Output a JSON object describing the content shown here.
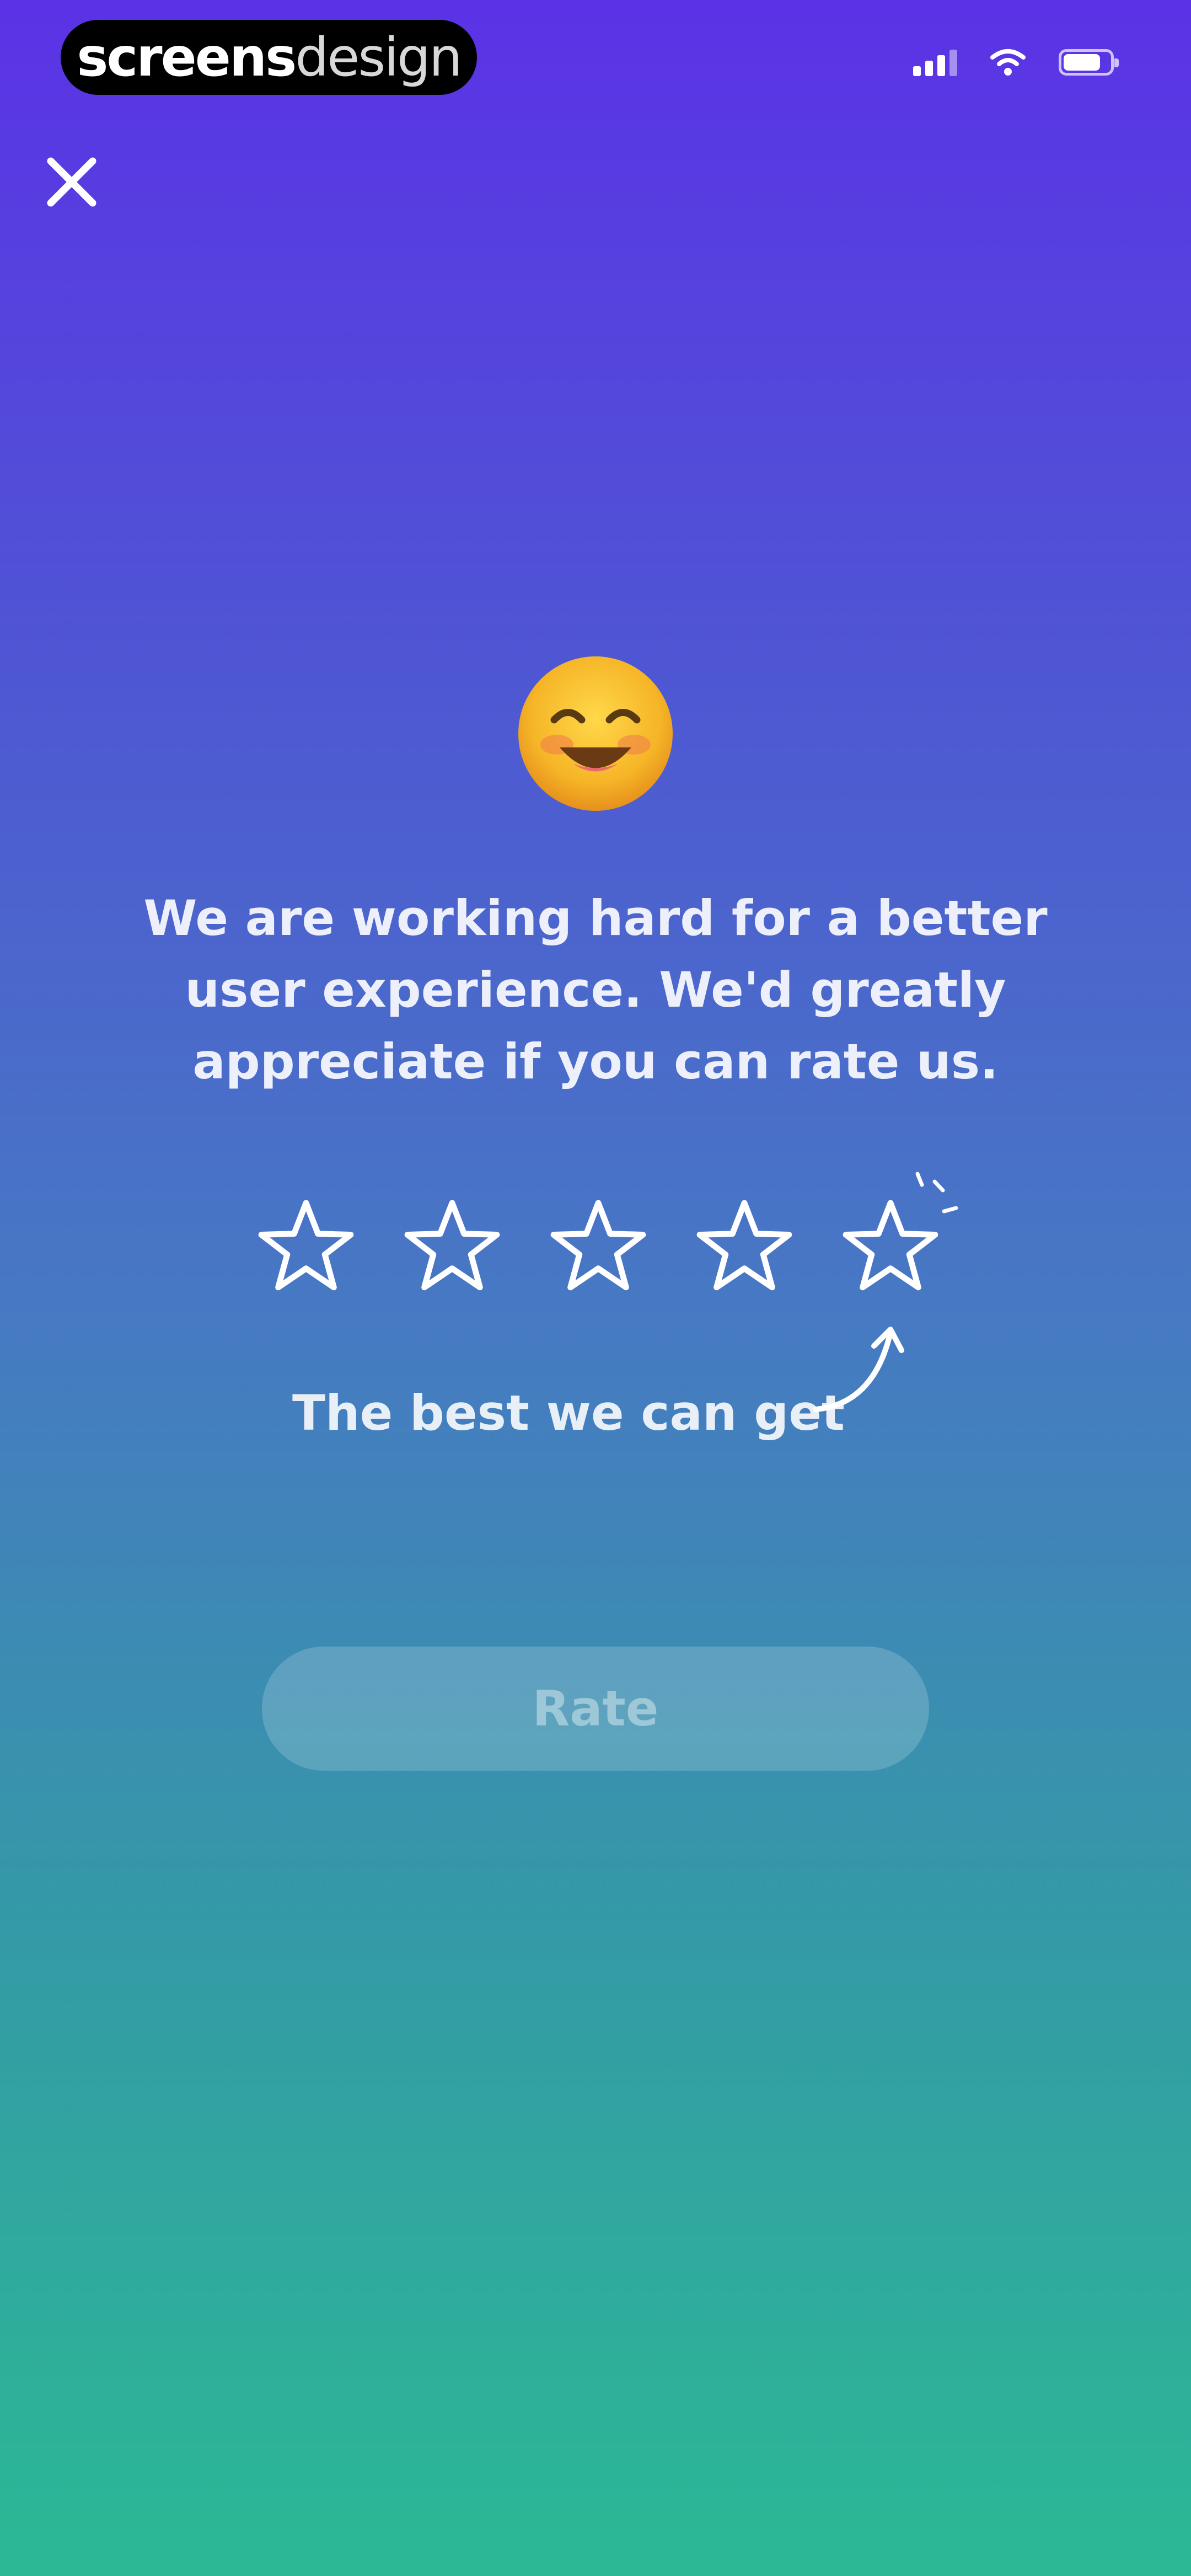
{
  "status_bar": {
    "brand_bold": "screens",
    "brand_light": "design",
    "icons": [
      "signal-icon",
      "wifi-icon",
      "battery-icon"
    ],
    "battery_level": 0.8
  },
  "header": {
    "close_icon": "close-icon"
  },
  "content": {
    "emoji": "smiling-face-icon",
    "message": "We are working hard for a better user experience. We'd greatly appreciate if you can rate us.",
    "stars": [
      {
        "icon": "star-icon",
        "filled": false
      },
      {
        "icon": "star-icon",
        "filled": false
      },
      {
        "icon": "star-icon",
        "filled": false
      },
      {
        "icon": "star-icon",
        "filled": false
      },
      {
        "icon": "star-icon",
        "filled": false
      }
    ],
    "rating": 0,
    "max_rating": 5,
    "hint": "The best we can get",
    "rate_button_label": "Rate",
    "rate_button_enabled": false
  },
  "colors": {
    "gradient_top": "#5b32e6",
    "gradient_bottom": "#2bb995",
    "star_outline": "#ffffff"
  }
}
